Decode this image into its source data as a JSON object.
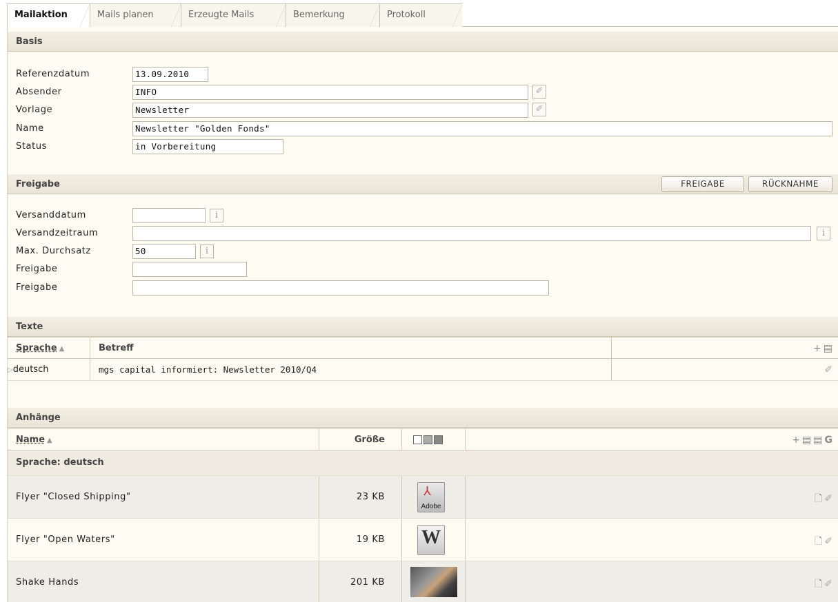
{
  "tabs": [
    "Mailaktion",
    "Mails planen",
    "Erzeugte Mails",
    "Bemerkung",
    "Protokoll"
  ],
  "sections": {
    "basis": "Basis",
    "freigabe": "Freigabe",
    "texte": "Texte",
    "anhaenge": "Anhänge"
  },
  "basis": {
    "referenzdatum_label": "Referenzdatum",
    "referenzdatum_value": "13.09.2010",
    "absender_label": "Absender",
    "absender_value": "INFO",
    "vorlage_label": "Vorlage",
    "vorlage_value": "Newsletter",
    "name_label": "Name",
    "name_value": "Newsletter \"Golden Fonds\"",
    "status_label": "Status",
    "status_value": "in Vorbereitung"
  },
  "freigabe": {
    "freigabe_button": "FREIGABE",
    "ruecknahme_button": "RÜCKNAHME",
    "versanddatum_label": "Versanddatum",
    "versanddatum_value": "",
    "versandzeitraum_label": "Versandzeitraum",
    "versandzeitraum_value": "",
    "durchsatz_label": "Max. Durchsatz",
    "durchsatz_value": "50",
    "freigabe1_label": "Freigabe",
    "freigabe1_value": "",
    "freigabe2_label": "Freigabe",
    "freigabe2_value": ""
  },
  "texte": {
    "columns": [
      "Sprache",
      "Betreff"
    ],
    "rows": [
      {
        "sprache": "deutsch",
        "betreff": "mgs capital informiert: Newsletter 2010/Q4"
      }
    ]
  },
  "anhaenge": {
    "columns": [
      "Name",
      "Größe"
    ],
    "group_label": "Sprache: deutsch",
    "rows": [
      {
        "name": "Flyer \"Closed Shipping\"",
        "size": "23 KB",
        "icon": "pdf-icon",
        "icon_text": "Adobe"
      },
      {
        "name": "Flyer \"Open Waters\"",
        "size": "19 KB",
        "icon": "word-icon",
        "icon_text": "W"
      },
      {
        "name": "Shake Hands",
        "size": "201 KB",
        "icon": "image-thumbnail",
        "icon_text": ""
      }
    ]
  },
  "icons": {
    "info": "i",
    "edit": "✐",
    "add": "+",
    "grid": "▤",
    "doc": "🗋",
    "g": "G"
  }
}
